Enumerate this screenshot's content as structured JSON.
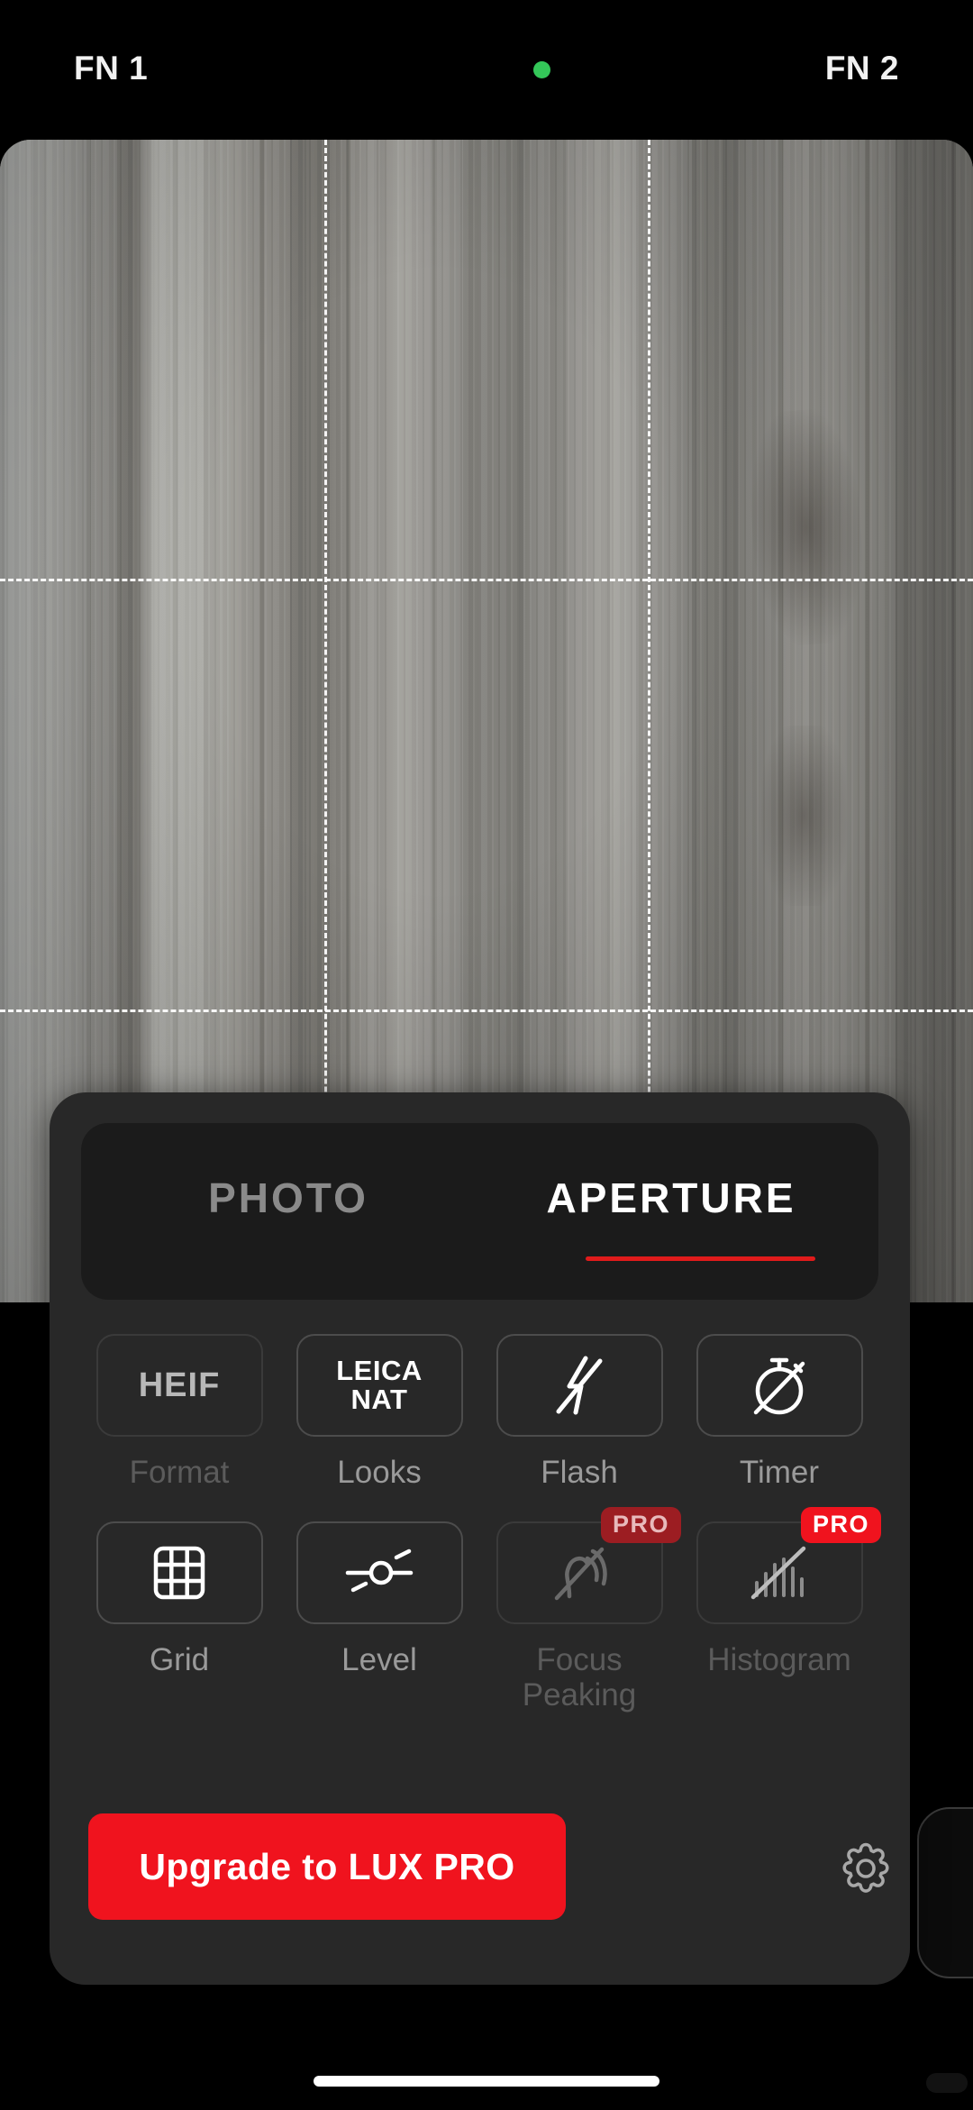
{
  "app": {
    "background_color": "#000000",
    "accent_color": "#f0131e"
  },
  "topbar": {
    "fn1_label": "FN 1",
    "fn2_label": "FN 2",
    "recording_indicator": {
      "name": "recording-dot",
      "color": "#34c759"
    }
  },
  "viewfinder": {
    "grid_enabled": true,
    "grid_type": "rule-of-thirds",
    "subject": "wood grain surface"
  },
  "sheet": {
    "tabs": [
      {
        "label": "PHOTO",
        "selected": false
      },
      {
        "label": "APERTURE",
        "selected": true
      }
    ],
    "selected_tab_underline_color": "#e01b1b",
    "options": [
      {
        "label": "Format",
        "value": "HEIF",
        "icon": "text-heif",
        "badge": null,
        "enabled": true,
        "active": false
      },
      {
        "label": "Looks",
        "value": "LEICA NAT",
        "value_line1": "LEICA",
        "value_line2": "NAT",
        "icon": "text-leica-nat",
        "badge": null,
        "enabled": true,
        "active": true
      },
      {
        "label": "Flash",
        "value": "Off",
        "icon": "flash-off-icon",
        "badge": null,
        "enabled": true,
        "active": true
      },
      {
        "label": "Timer",
        "value": "Off",
        "icon": "timer-off-icon",
        "badge": null,
        "enabled": true,
        "active": true
      },
      {
        "label": "Grid",
        "value": "On",
        "icon": "grid-icon",
        "badge": null,
        "enabled": true,
        "active": true
      },
      {
        "label": "Level",
        "value": "Off",
        "icon": "level-icon",
        "badge": null,
        "enabled": true,
        "active": true
      },
      {
        "label": "Focus Peaking",
        "value": "Off",
        "icon": "focus-peaking-off-icon",
        "badge": "PRO",
        "enabled": false,
        "active": false
      },
      {
        "label": "Histogram",
        "value": "Off",
        "icon": "histogram-off-icon",
        "badge": "PRO",
        "enabled": false,
        "active": false
      }
    ],
    "upgrade_button": {
      "label": "Upgrade to LUX PRO",
      "color": "#f0131e"
    },
    "settings_button": {
      "icon": "gear-icon"
    }
  }
}
